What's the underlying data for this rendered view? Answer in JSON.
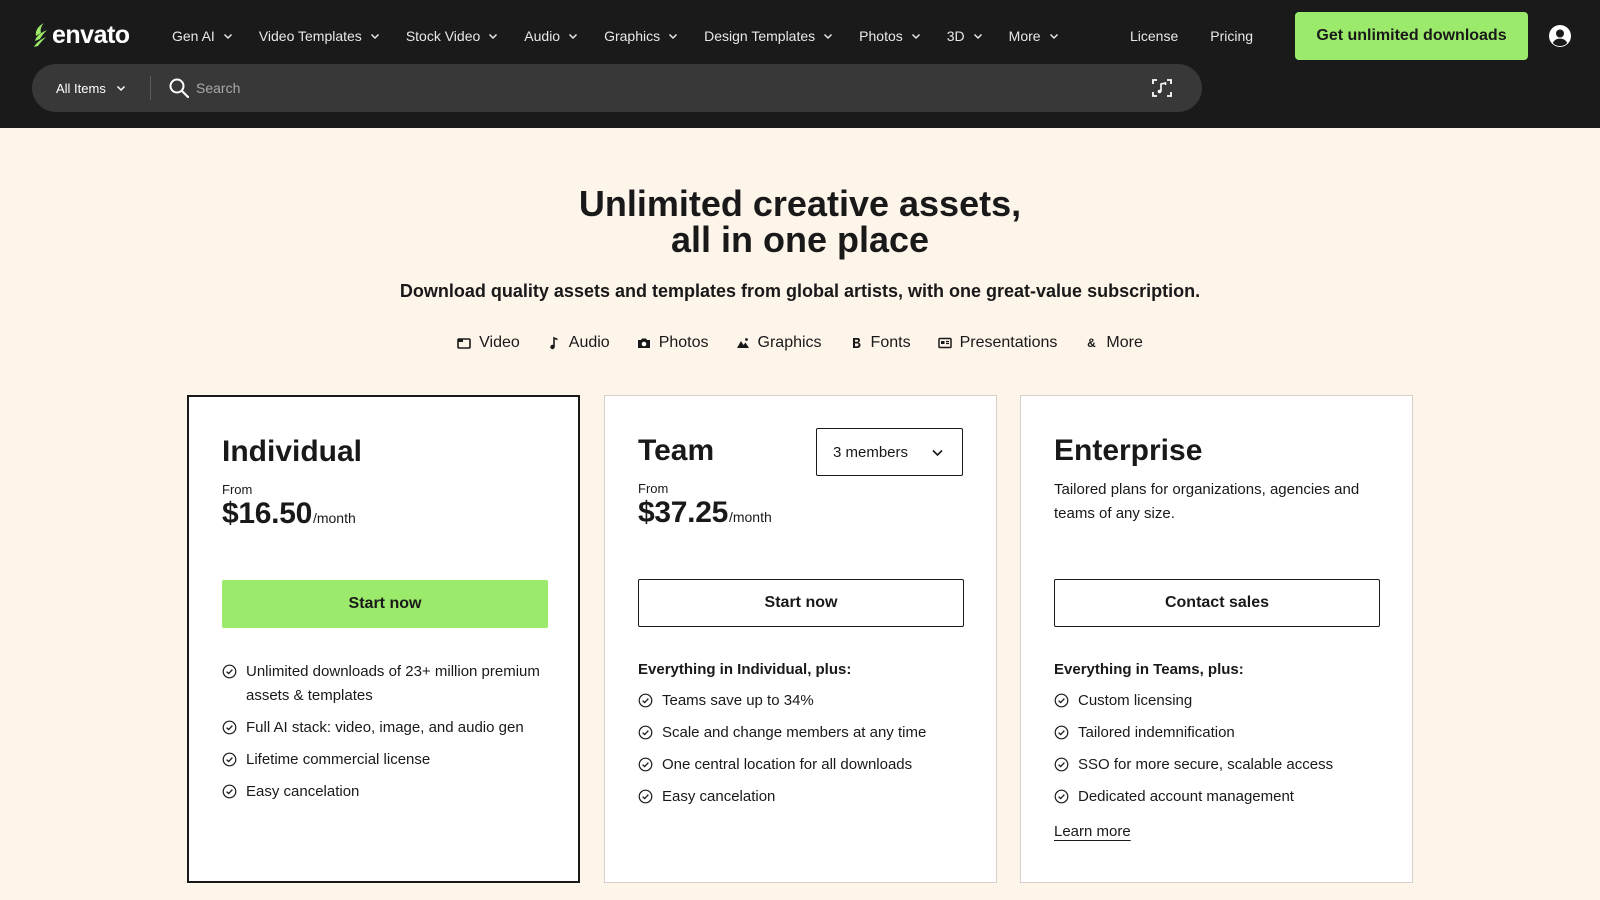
{
  "header": {
    "logo_text": "envato",
    "brand_color": "#9bea6b",
    "nav": [
      {
        "label": "Gen AI"
      },
      {
        "label": "Video Templates"
      },
      {
        "label": "Stock Video"
      },
      {
        "label": "Audio"
      },
      {
        "label": "Graphics"
      },
      {
        "label": "Design Templates"
      },
      {
        "label": "Photos"
      },
      {
        "label": "3D"
      },
      {
        "label": "More"
      }
    ],
    "license_label": "License",
    "pricing_label": "Pricing",
    "cta_label": "Get unlimited downloads",
    "user_icon": "user-circle-icon"
  },
  "search": {
    "scope_label": "All Items",
    "placeholder": "Search",
    "value": ""
  },
  "hero": {
    "title_line1": "Unlimited creative assets,",
    "title_line2": "all in one place",
    "subtitle": "Download quality assets and templates from global artists, with one great-value subscription.",
    "categories": [
      {
        "label": "Video",
        "icon": "video-icon"
      },
      {
        "label": "Audio",
        "icon": "music-note-icon"
      },
      {
        "label": "Photos",
        "icon": "camera-icon"
      },
      {
        "label": "Graphics",
        "icon": "mountain-icon"
      },
      {
        "label": "Fonts",
        "icon": "font-icon"
      },
      {
        "label": "Presentations",
        "icon": "presentation-icon"
      },
      {
        "label": "More",
        "icon": "ampersand-icon"
      }
    ]
  },
  "plans": {
    "individual": {
      "title": "Individual",
      "from": "From",
      "price": "$16.50",
      "per": "/month",
      "button": "Start now",
      "features": [
        "Unlimited downloads of 23+ million premium assets & templates",
        "Full AI stack: video, image, and audio gen",
        "Lifetime commercial license",
        "Easy cancelation"
      ]
    },
    "team": {
      "title": "Team",
      "members_value": "3 members",
      "from": "From",
      "price": "$37.25",
      "per": "/month",
      "button": "Start now",
      "plus_heading": "Everything in Individual, plus:",
      "features": [
        "Teams save up to 34%",
        "Scale and change members at any time",
        "One central location for all downloads",
        "Easy cancelation"
      ]
    },
    "enterprise": {
      "title": "Enterprise",
      "description": "Tailored plans for organizations, agencies and teams of any size.",
      "button": "Contact sales",
      "plus_heading": "Everything in Teams, plus:",
      "features": [
        "Custom licensing",
        "Tailored indemnification",
        "SSO for more secure, scalable access",
        "Dedicated account management"
      ],
      "learn_more": "Learn more"
    }
  }
}
